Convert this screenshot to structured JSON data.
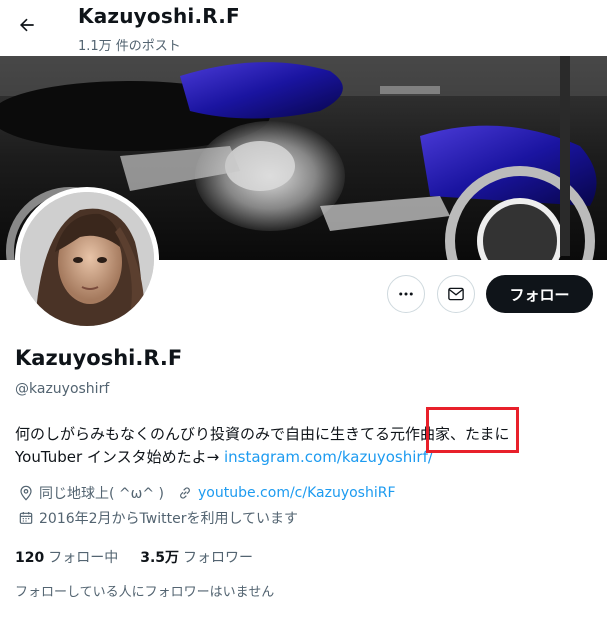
{
  "header": {
    "title": "Kazuyoshi.R.F",
    "post_count": "1.1万 件のポスト"
  },
  "actions": {
    "follow_label": "フォロー"
  },
  "profile": {
    "display_name": "Kazuyoshi.R.F",
    "handle": "@kazuyoshirf",
    "bio_line1": "何のしがらみもなくのんびり投資のみで自由に生きてる元作曲家、たまに",
    "bio_line2_text": "YouTuber インスタ始めたよ→ ",
    "bio_link": "instagram.com/kazuyoshirf/",
    "location": "同じ地球上( ^ω^ )",
    "website": "youtube.com/c/KazuyoshiRF",
    "joined": "2016年2月からTwitterを利用しています",
    "following_count": "120",
    "following_label": "フォロー中",
    "followers_count": "3.5万",
    "followers_label": "フォロワー",
    "mutual_note": "フォローしている人にフォロワーはいません"
  },
  "icons": {
    "back": "back-arrow-icon",
    "more": "more-icon",
    "message": "mail-icon",
    "location": "location-pin-icon",
    "link": "link-icon",
    "calendar": "calendar-icon"
  },
  "colors": {
    "link": "#1d9bf0",
    "follow_button": "#0f1419",
    "highlight": "#e8202a"
  }
}
